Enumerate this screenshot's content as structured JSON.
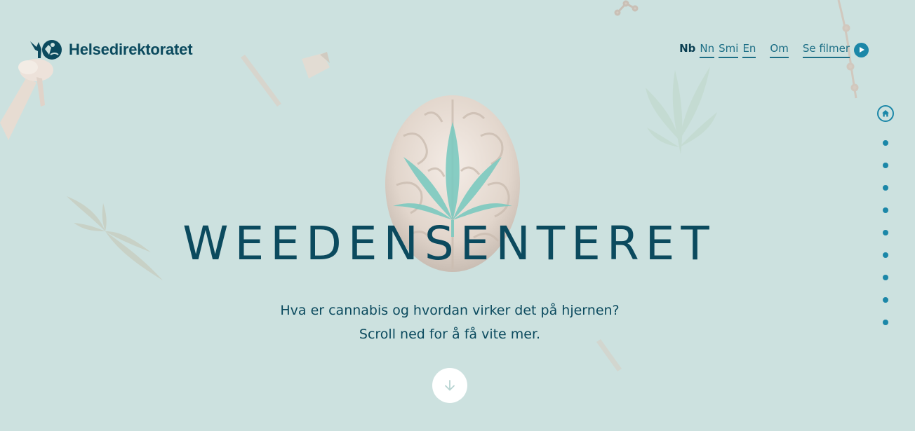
{
  "brand": {
    "name": "Helsedirektoratet",
    "logo_icon": "helsedirektoratet-logo-icon"
  },
  "nav": {
    "languages": [
      {
        "label": "Nb",
        "active": true
      },
      {
        "label": "Nn",
        "active": false
      },
      {
        "label": "Smi",
        "active": false
      },
      {
        "label": "En",
        "active": false
      }
    ],
    "about_label": "Om",
    "films_label": "Se filmer",
    "films_icon": "play-icon"
  },
  "hero": {
    "title": "WEEDENSENTERET",
    "line1": "Hva er cannabis og hvordan virker det på hjernen?",
    "line2": "Scroll ned for å få vite mer.",
    "scroll_icon": "arrow-down-icon"
  },
  "side_nav": {
    "home_icon": "home-icon",
    "section_count": 9
  },
  "colors": {
    "background": "#cce1df",
    "primary_text": "#0b4a5e",
    "accent": "#1b87a8",
    "leaf": "#7ccac0"
  }
}
